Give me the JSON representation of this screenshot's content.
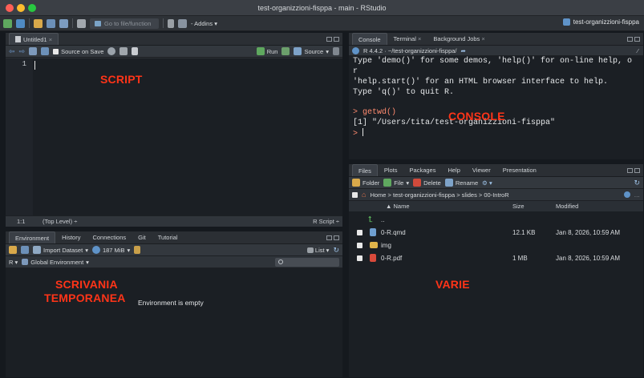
{
  "window": {
    "title": "test-organizzioni-fisppa - main - RStudio",
    "project": "test-organizzioni-fisppa"
  },
  "toolbar": {
    "goto_placeholder": "Go to file/function",
    "addins": "Addins"
  },
  "source": {
    "tab": "Untitled1",
    "source_on_save": "Source on Save",
    "run": "Run",
    "source_btn": "Source",
    "line_number": "1",
    "status_pos": "1:1",
    "status_scope": "(Top Level)",
    "status_type": "R Script"
  },
  "env": {
    "tabs": [
      "Environment",
      "History",
      "Connections",
      "Git",
      "Tutorial"
    ],
    "import_dataset": "Import Dataset",
    "memory": "187 MiB",
    "list_view": "List",
    "language": "R",
    "scope": "Global Environment",
    "empty_msg": "Environment is empty"
  },
  "console": {
    "tabs": [
      "Console",
      "Terminal",
      "Background Jobs"
    ],
    "version_path": "R 4.4.2 · ~/test-organizzioni-fisppa/",
    "lines": [
      "Type 'demo()' for some demos, 'help()' for on-line help, o",
      "r",
      "'help.start()' for an HTML browser interface to help.",
      "Type 'q()' to quit R."
    ],
    "cmd": "> getwd()",
    "output": "[1] \"/Users/tita/test-organizzioni-fisppa\"",
    "prompt": ">"
  },
  "files": {
    "tabs": [
      "Files",
      "Plots",
      "Packages",
      "Help",
      "Viewer",
      "Presentation"
    ],
    "toolbar": [
      "Folder",
      "File",
      "Delete",
      "Rename"
    ],
    "breadcrumb": "Home > test-organizzioni-fisppa > slides > 00-IntroR",
    "headers": {
      "name": "▲ Name",
      "size": "Size",
      "modified": "Modified"
    },
    "up": "..",
    "rows": [
      {
        "name": "0-R.qmd",
        "size": "12.1 KB",
        "modified": "Jan 8, 2026, 10:59 AM"
      },
      {
        "name": "img",
        "size": "",
        "modified": ""
      },
      {
        "name": "0-R.pdf",
        "size": "1 MB",
        "modified": "Jan 8, 2026, 10:59 AM"
      }
    ]
  },
  "overlay_labels": {
    "script": "SCRIPT",
    "console": "CONSOLE",
    "scrivania": "SCRIVANIA",
    "temporanea": "TEMPORANEA",
    "varie": "VARIE"
  }
}
